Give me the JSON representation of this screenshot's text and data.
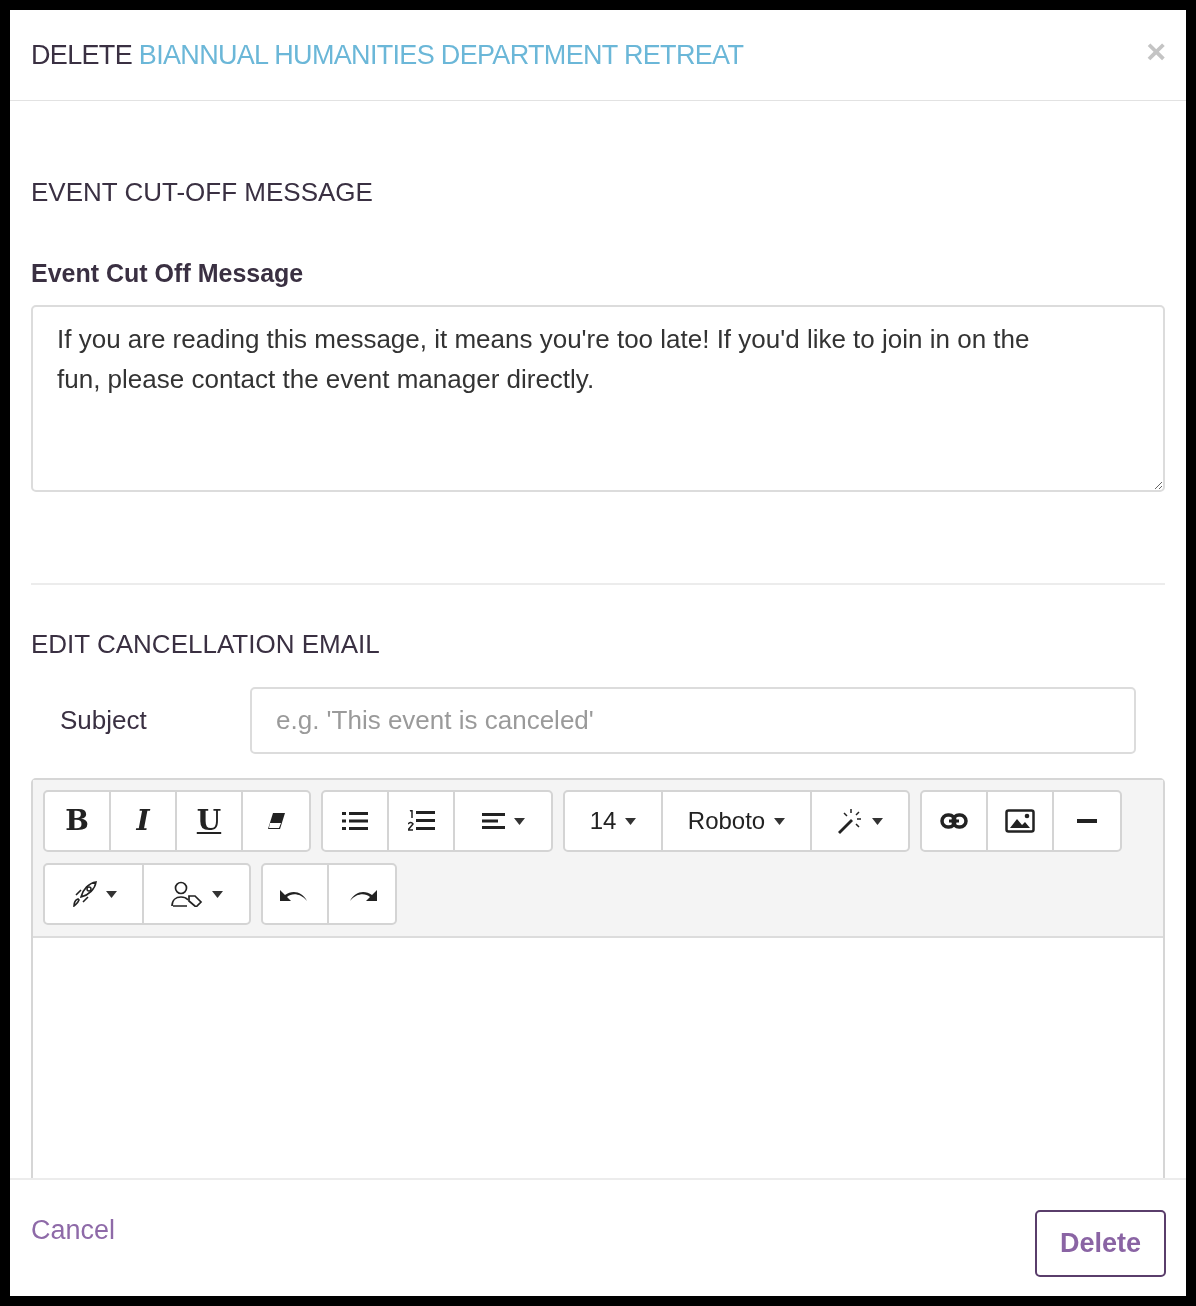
{
  "dialog": {
    "title_prefix": "DELETE",
    "title_event": "BIANNUAL HUMANITIES DEPARTMENT RETREAT",
    "close": "×"
  },
  "cutoff_section": {
    "heading": "EVENT CUT-OFF MESSAGE",
    "label": "Event Cut Off Message",
    "value": "If you are reading this message, it means you're too late! If you'd like to join in on the fun, please contact the event manager directly."
  },
  "email_section": {
    "heading": "EDIT CANCELLATION EMAIL",
    "subject_label": "Subject",
    "subject_placeholder": "e.g. 'This event is canceled'",
    "toolbar_rows": [
      [
        [
          {
            "kind": "bold",
            "label": "B"
          },
          {
            "kind": "italic",
            "label": "I"
          },
          {
            "kind": "underline",
            "label": "U"
          },
          {
            "kind": "eraser"
          }
        ],
        [
          {
            "kind": "bullets"
          },
          {
            "kind": "numbers"
          },
          {
            "kind": "align"
          }
        ],
        [
          {
            "kind": "text",
            "label": "14"
          },
          {
            "kind": "text",
            "label": "Roboto"
          },
          {
            "kind": "wand"
          }
        ],
        [
          {
            "kind": "link"
          },
          {
            "kind": "image"
          },
          {
            "kind": "rule"
          }
        ]
      ],
      [
        [
          {
            "kind": "rocket"
          },
          {
            "kind": "persontag"
          }
        ],
        [
          {
            "kind": "undo"
          },
          {
            "kind": "redo"
          }
        ]
      ]
    ]
  },
  "footer": {
    "cancel": "Cancel",
    "delete": "Delete"
  }
}
